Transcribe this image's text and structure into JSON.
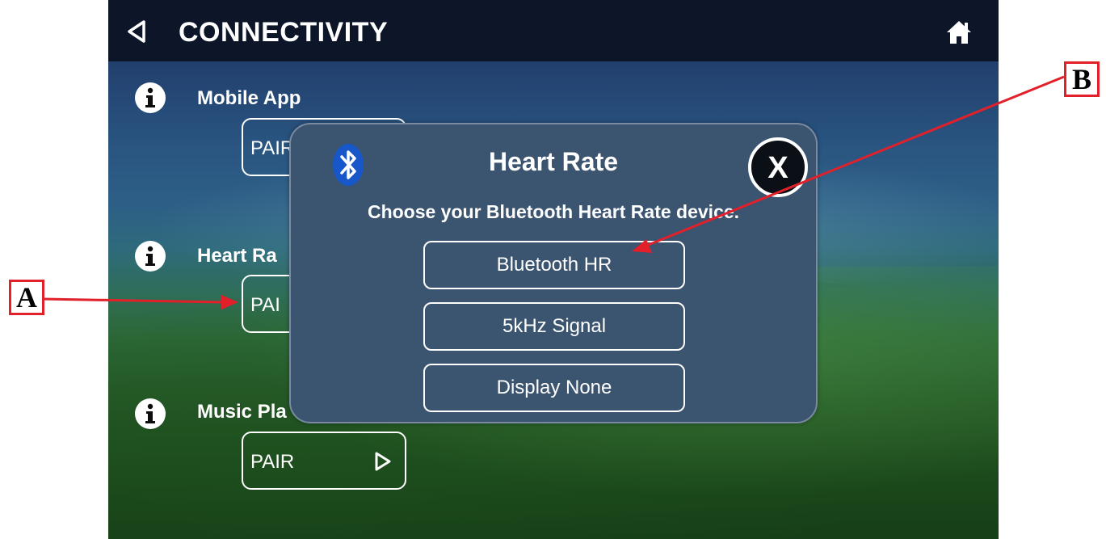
{
  "header": {
    "title": "CONNECTIVITY",
    "back_icon": "back-triangle-icon",
    "home_icon": "home-icon"
  },
  "rows": [
    {
      "label": "Mobile App",
      "button_label": "PAIR"
    },
    {
      "label": "Heart Ra",
      "button_label": "PAI"
    },
    {
      "label": "Music Pla",
      "button_label": "PAIR"
    }
  ],
  "modal": {
    "title": "Heart Rate",
    "subtitle": "Choose your Bluetooth Heart Rate device.",
    "close_label": "X",
    "options": [
      "Bluetooth HR",
      "5kHz Signal",
      "Display None"
    ],
    "icon": "bluetooth-icon"
  },
  "callouts": {
    "a": "A",
    "b": "B"
  },
  "colors": {
    "callout_border": "#e2202a",
    "modal_bg": "#3b5470",
    "topbar_bg": "#0c1628"
  }
}
